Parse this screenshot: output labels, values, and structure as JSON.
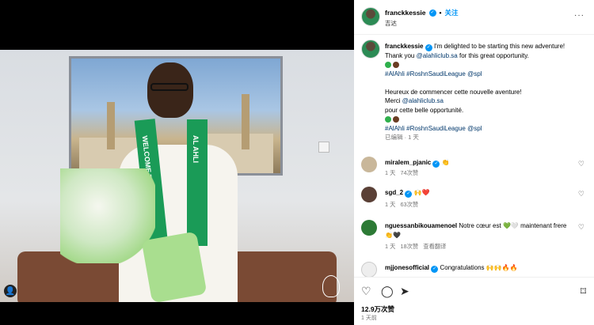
{
  "post": {
    "username": "franckkessie",
    "follow_label": "关注",
    "location": "吉达",
    "more_label": "···"
  },
  "caption": {
    "username": "franckkessie",
    "line1": "I'm delighted to be starting this new adventure!",
    "thank_pre": "Thank you",
    "mention": "@alahliclub.sa",
    "thank_post": "for this great opportunity.",
    "hashtags": "#AlAhli #RoshnSaudiLeague @spl",
    "fr_line1": "Heureux de commencer cette nouvelle aventure!",
    "fr_merci": "Merci",
    "fr_mention": "@alahliclub.sa",
    "fr_line3": "pour cette belle opportunité.",
    "hashtags2": "#AlAhli #RoshnSaudiLeague @spl",
    "meta": "已编辑 · 1 天"
  },
  "comments": [
    {
      "user": "miralem_pjanic",
      "text": "👏",
      "age": "1 天",
      "likes": "74次赞"
    },
    {
      "user": "sgd_2",
      "text": "🙌❤️",
      "age": "1 天",
      "likes": "63次赞"
    },
    {
      "user": "nguessanbikouamenoel",
      "text": "Notre cœur est 💚🤍 maintenant frere 👏🖤",
      "age": "1 天",
      "likes": "18次赞",
      "translate": "查看翻译"
    },
    {
      "user": "mjjonesofficial",
      "text": "Congratulations 🙌🙌🔥🔥"
    }
  ],
  "footer": {
    "likes": "12.9万次赞",
    "age": "1 天前"
  },
  "image": {
    "scarf_text": "AL AHLI",
    "scarf_text2": "WELCOME TO"
  },
  "colors": {
    "accent": "#0095f6",
    "link": "#00376b",
    "scarf_green": "#1a9b57"
  }
}
